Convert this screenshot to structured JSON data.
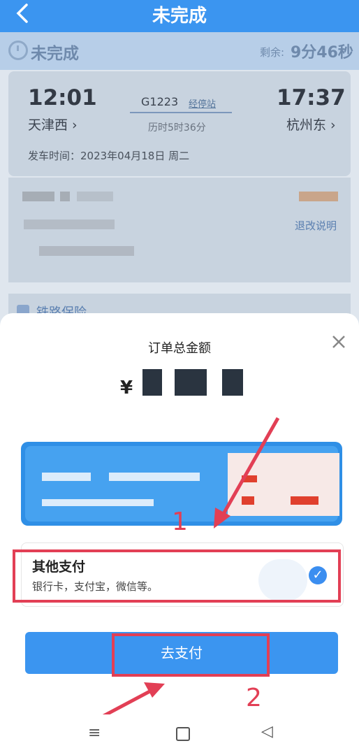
{
  "header": {
    "back_icon": "chevron-left-icon",
    "title": "未完成"
  },
  "status": {
    "label": "未完成",
    "remaining_label": "剩余:",
    "remaining_value": "9分46秒"
  },
  "trip": {
    "depart_time": "12:01",
    "depart_station": "天津西 ›",
    "train_no": "G1223",
    "stops_link": "经停站",
    "duration": "历时5时36分",
    "arrive_time": "17:37",
    "arrive_station": "杭州东 ›",
    "depart_date": "发车时间：2023年04月18日 周二"
  },
  "passenger": {
    "modify_link": "退改说明"
  },
  "insurance": {
    "label": "铁路保险"
  },
  "sheet": {
    "title": "订单总金额",
    "currency": "¥",
    "close_icon": "close-icon",
    "payment_option": {
      "name": "其他支付",
      "desc": "银行卡，支付宝，微信等。"
    },
    "pay_button": "去支付"
  },
  "annotations": {
    "step1": "1",
    "step2": "2"
  },
  "colors": {
    "primary": "#3b95f0",
    "annotation": "#e23f55"
  },
  "navbar": {
    "menu_icon": "menu-icon",
    "home_icon": "home-icon",
    "back_icon": "back-triangle-icon"
  }
}
